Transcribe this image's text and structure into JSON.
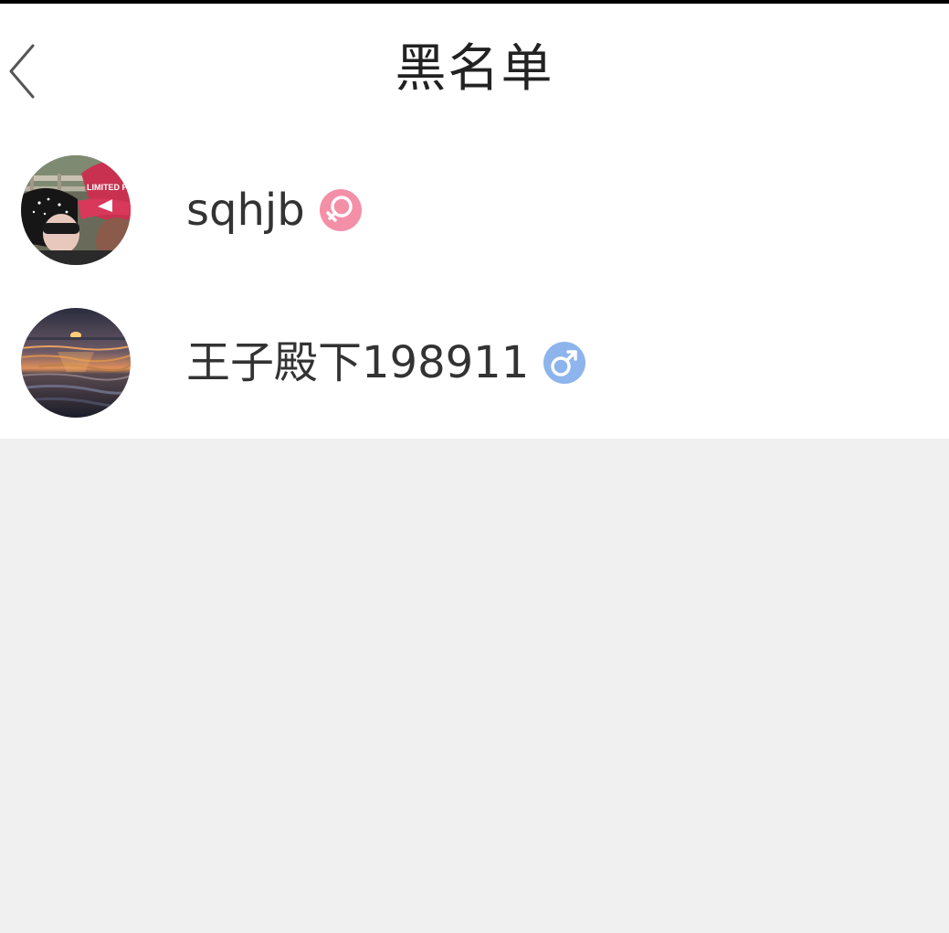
{
  "header": {
    "title": "黑名单",
    "back_icon": "chevron-left-icon"
  },
  "blacklist": {
    "items": [
      {
        "username": "sqhjb",
        "gender": "female",
        "gender_icon": "female-icon",
        "gender_color": "#f48fa8",
        "avatar_desc": "avatar-photo-selfie",
        "avatar_caption": "LIMITED P"
      },
      {
        "username": "王子殿下198911",
        "gender": "male",
        "gender_icon": "male-icon",
        "gender_color": "#8db4ec",
        "avatar_desc": "avatar-photo-sunset"
      }
    ]
  },
  "colors": {
    "page_background": "#f0f0f0",
    "surface": "#ffffff",
    "text_primary": "#333333"
  }
}
